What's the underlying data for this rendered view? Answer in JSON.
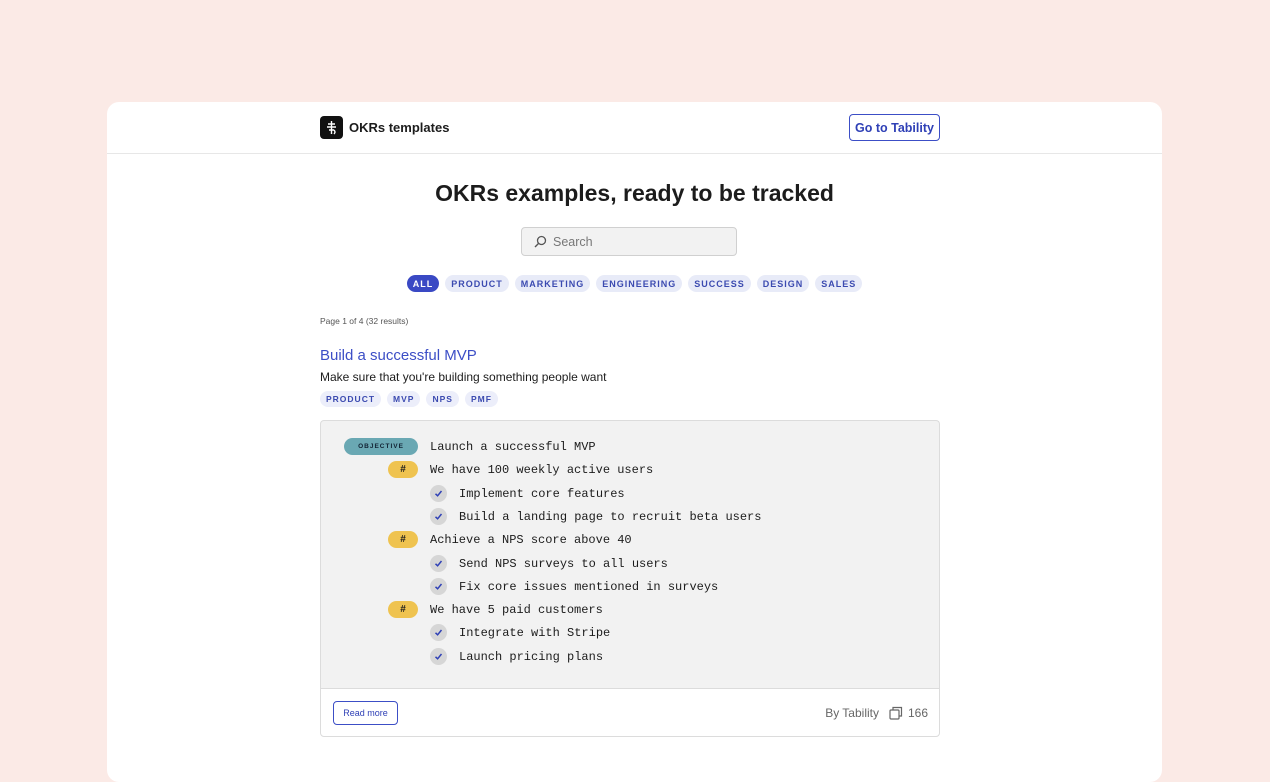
{
  "header": {
    "brand": "OKRs templates",
    "cta": "Go to Tability"
  },
  "main": {
    "headline": "OKRs examples, ready to be tracked",
    "search_placeholder": "Search",
    "filters": [
      {
        "label": "ALL",
        "active": true
      },
      {
        "label": "PRODUCT",
        "active": false
      },
      {
        "label": "MARKETING",
        "active": false
      },
      {
        "label": "ENGINEERING",
        "active": false
      },
      {
        "label": "SUCCESS",
        "active": false
      },
      {
        "label": "DESIGN",
        "active": false
      },
      {
        "label": "SALES",
        "active": false
      }
    ],
    "page_info": "Page 1 of 4 (32 results)"
  },
  "template": {
    "title": "Build a successful MVP",
    "subtitle": "Make sure that you're building something people want",
    "tags": [
      "PRODUCT",
      "MVP",
      "NPS",
      "PMF"
    ],
    "objective_badge": "OBJECTIVE",
    "kr_badge": "#",
    "objective": "Launch a successful MVP",
    "key_results": [
      {
        "text": "We have 100 weekly active users",
        "initiatives": [
          "Implement core features",
          "Build a landing page to recruit beta users"
        ]
      },
      {
        "text": "Achieve a NPS score above 40",
        "initiatives": [
          "Send NPS surveys to all users",
          "Fix core issues mentioned in surveys"
        ]
      },
      {
        "text": "We have 5 paid customers",
        "initiatives": [
          "Integrate with Stripe",
          "Launch pricing plans"
        ]
      }
    ],
    "read_more": "Read more",
    "author": "By Tability",
    "copies": "166"
  },
  "colors": {
    "background": "#fbeae6",
    "accent": "#3a49c4",
    "objective": "#6aa8b3",
    "key_result": "#efc350"
  }
}
